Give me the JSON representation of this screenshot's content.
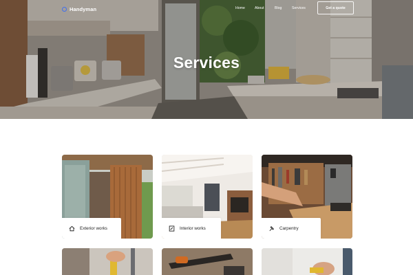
{
  "brand": {
    "name": "Handyman",
    "accent": "#3f6ef0"
  },
  "nav": {
    "home": "Home",
    "about": "About",
    "blog": "Blog",
    "services": "Services",
    "cta": "Get a quote"
  },
  "hero": {
    "title": "Services"
  },
  "services": [
    {
      "label": "Exterior works",
      "icon": "house-icon"
    },
    {
      "label": "Interior works",
      "icon": "document-edit-icon"
    },
    {
      "label": "Carpentry",
      "icon": "hammer-icon"
    }
  ]
}
